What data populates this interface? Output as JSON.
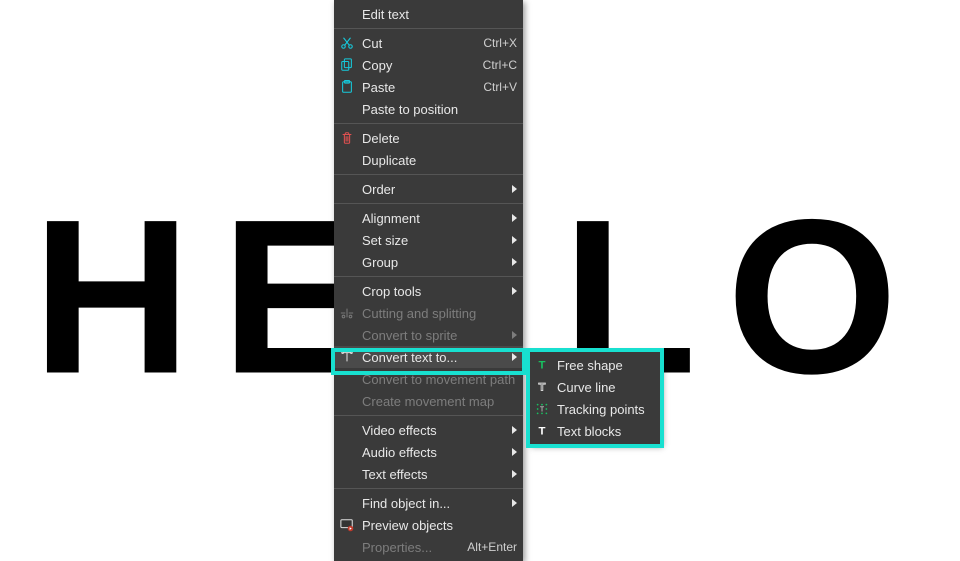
{
  "canvas": {
    "text": "HELLO"
  },
  "menu": {
    "edit_text": "Edit text",
    "cut": "Cut",
    "cut_key": "Ctrl+X",
    "copy": "Copy",
    "copy_key": "Ctrl+C",
    "paste": "Paste",
    "paste_key": "Ctrl+V",
    "paste_pos": "Paste to position",
    "delete": "Delete",
    "duplicate": "Duplicate",
    "order": "Order",
    "alignment": "Alignment",
    "set_size": "Set size",
    "group": "Group",
    "crop_tools": "Crop tools",
    "cut_split": "Cutting and splitting",
    "convert_sprite": "Convert to sprite",
    "convert_text": "Convert text to...",
    "convert_mpath": "Convert to movement path",
    "create_mmap": "Create movement map",
    "video_fx": "Video effects",
    "audio_fx": "Audio effects",
    "text_fx": "Text effects",
    "find_obj": "Find object in...",
    "preview": "Preview objects",
    "properties": "Properties...",
    "properties_key": "Alt+Enter"
  },
  "submenu": {
    "free_shape": "Free shape",
    "curve_line": "Curve line",
    "tracking_points": "Tracking points",
    "text_blocks": "Text blocks"
  },
  "colors": {
    "highlight": "#18e0d0"
  }
}
